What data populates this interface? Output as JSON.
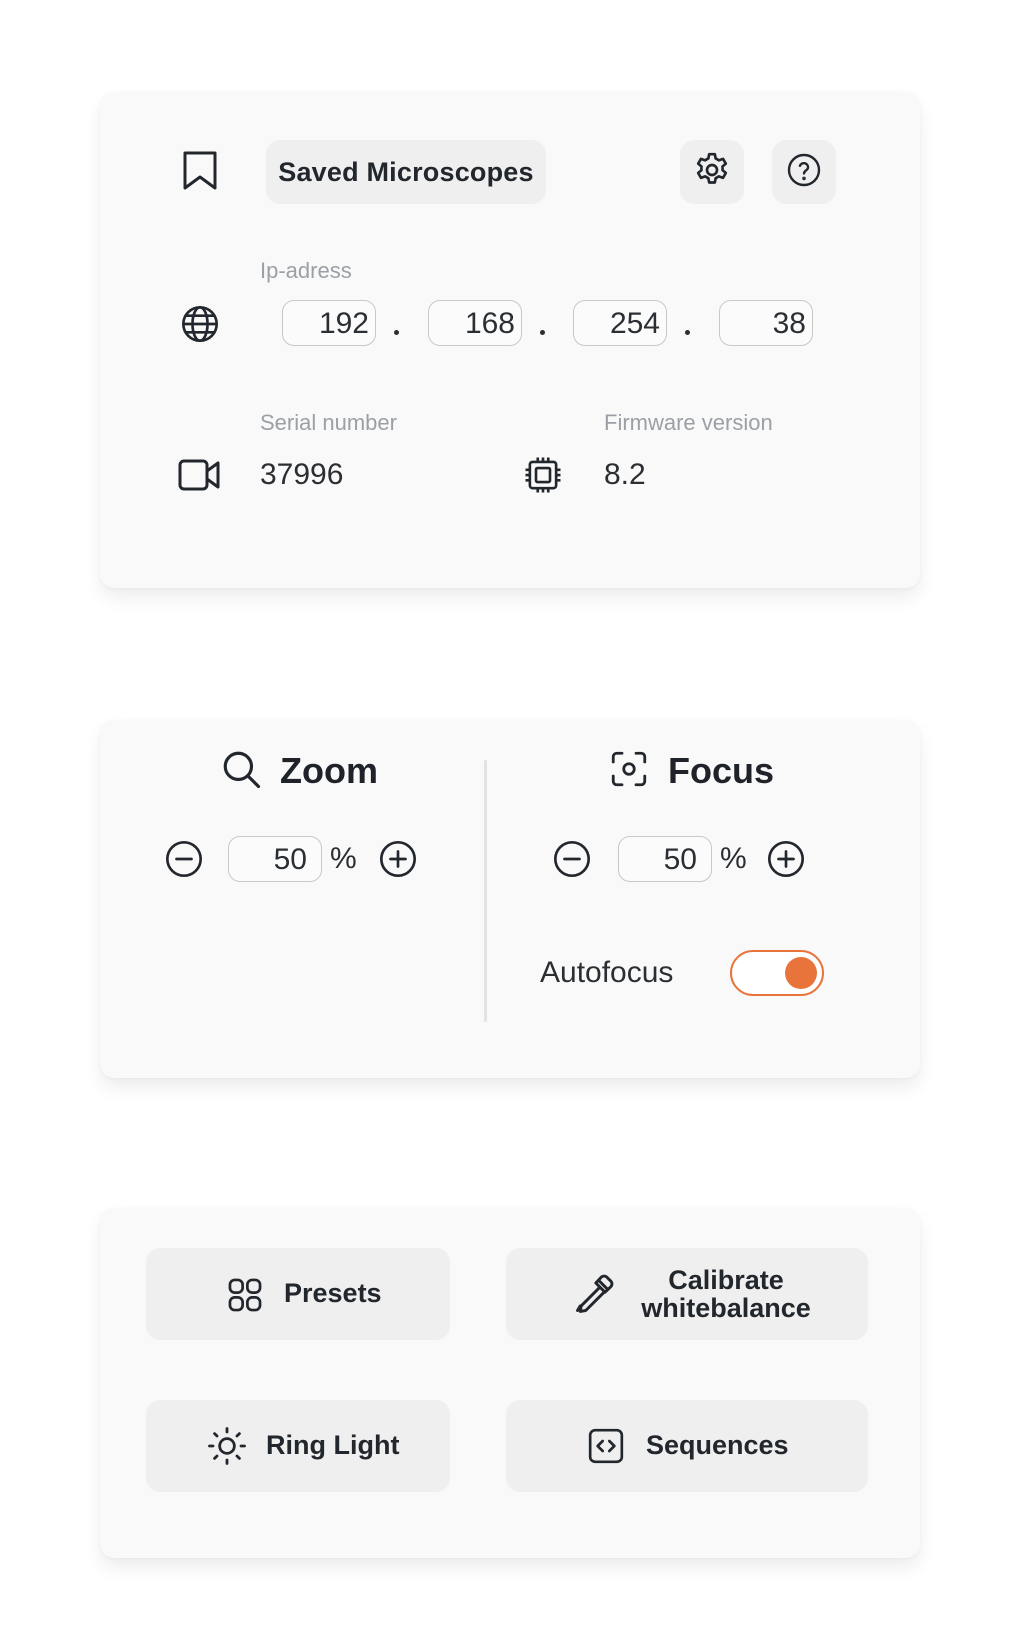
{
  "device": {
    "saved_button_label": "Saved Microscopes",
    "ip_label": "Ip-adress",
    "ip_octets": [
      "192",
      "168",
      "254",
      "38"
    ],
    "serial_label": "Serial number",
    "serial_value": "37996",
    "firmware_label": "Firmware version",
    "firmware_value": "8.2"
  },
  "zoom": {
    "title": "Zoom",
    "value": "50",
    "unit": "%"
  },
  "focus": {
    "title": "Focus",
    "value": "50",
    "unit": "%",
    "autofocus_label": "Autofocus",
    "autofocus_on": true
  },
  "actions": {
    "presets_label": "Presets",
    "calibrate_line1": "Calibrate",
    "calibrate_line2": "whitebalance",
    "ring_light_label": "Ring Light",
    "sequences_label": "Sequences"
  },
  "colors": {
    "accent": "#e8743b",
    "card_bg": "#f9f9f9",
    "button_bg": "#efefef",
    "label_gray": "#9aa0a6"
  },
  "icons": [
    "bookmark-icon",
    "gear-icon",
    "help-icon",
    "globe-icon",
    "video-camera-icon",
    "chip-icon",
    "search-icon",
    "focus-icon",
    "minus-circle-icon",
    "plus-circle-icon",
    "grid-icon",
    "eyedropper-icon",
    "sun-icon",
    "code-icon"
  ]
}
